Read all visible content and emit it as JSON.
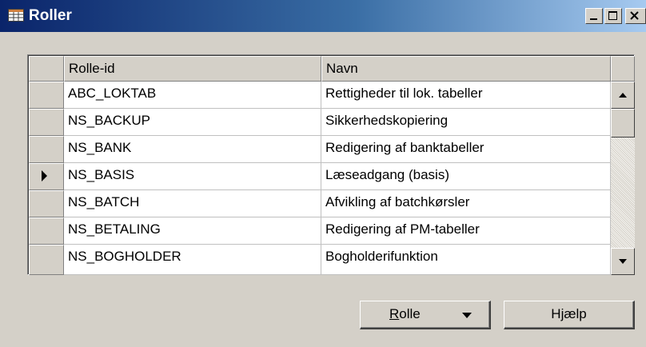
{
  "window": {
    "title": "Roller",
    "icon": "table-icon",
    "controls": [
      "minimize-icon",
      "maximize-icon",
      "close-icon"
    ]
  },
  "grid": {
    "columns": [
      "Rolle-id",
      "Navn"
    ],
    "rows": [
      {
        "id": "ABC_LOKTAB",
        "name": "Rettigheder til lok. tabeller",
        "current": false
      },
      {
        "id": "NS_BACKUP",
        "name": "Sikkerhedskopiering",
        "current": false
      },
      {
        "id": "NS_BANK",
        "name": "Redigering af banktabeller",
        "current": false
      },
      {
        "id": "NS_BASIS",
        "name": "Læseadgang (basis)",
        "current": true
      },
      {
        "id": "NS_BATCH",
        "name": "Afvikling af batchkørsler",
        "current": false
      },
      {
        "id": "NS_BETALING",
        "name": "Redigering af PM-tabeller",
        "current": false
      },
      {
        "id": "NS_BOGHOLDER",
        "name": "Bogholderifunktion",
        "current": false
      }
    ]
  },
  "buttons": {
    "rolle_underlined": "R",
    "rolle_rest": "olle",
    "help_label": "Hjælp"
  }
}
